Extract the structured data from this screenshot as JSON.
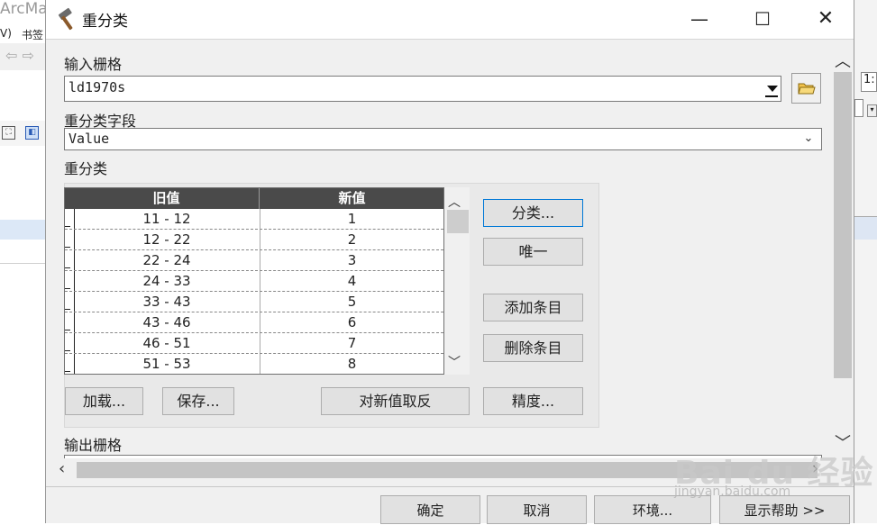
{
  "background_window": {
    "title_fragment": "ArcMa",
    "menu_fragment": "V)",
    "menu_bookmark": "书签",
    "right_box_text": "1:"
  },
  "dialog": {
    "title": "重分类",
    "title_icon": "hammer-icon",
    "window_buttons": {
      "minimize": "—",
      "maximize": "☐",
      "close": "✕"
    }
  },
  "input_raster": {
    "label": "输入栅格",
    "value": "ld1970s"
  },
  "reclass_field": {
    "label": "重分类字段",
    "value": "Value"
  },
  "reclassification": {
    "label": "重分类",
    "columns": [
      "旧值",
      "新值"
    ],
    "rows": [
      {
        "old": "11 - 12",
        "new": "1"
      },
      {
        "old": "12 - 22",
        "new": "2"
      },
      {
        "old": "22 - 24",
        "new": "3"
      },
      {
        "old": "24 - 33",
        "new": "4"
      },
      {
        "old": "33 - 43",
        "new": "5"
      },
      {
        "old": "43 - 46",
        "new": "6"
      },
      {
        "old": "46 - 51",
        "new": "7"
      },
      {
        "old": "51 - 53",
        "new": "8"
      }
    ],
    "buttons": {
      "classify": "分类...",
      "unique": "唯一",
      "add_entry": "添加条目",
      "delete_entry": "删除条目",
      "load": "加载...",
      "save": "保存...",
      "reverse": "对新值取反",
      "precision": "精度..."
    }
  },
  "output_raster": {
    "label": "输出栅格"
  },
  "footer": {
    "ok": "确定",
    "cancel": "取消",
    "environments": "环境...",
    "show_help": "显示帮助 >>"
  },
  "watermark": {
    "logo": "Bai du 经验",
    "url": "jingyan.baidu.com"
  }
}
